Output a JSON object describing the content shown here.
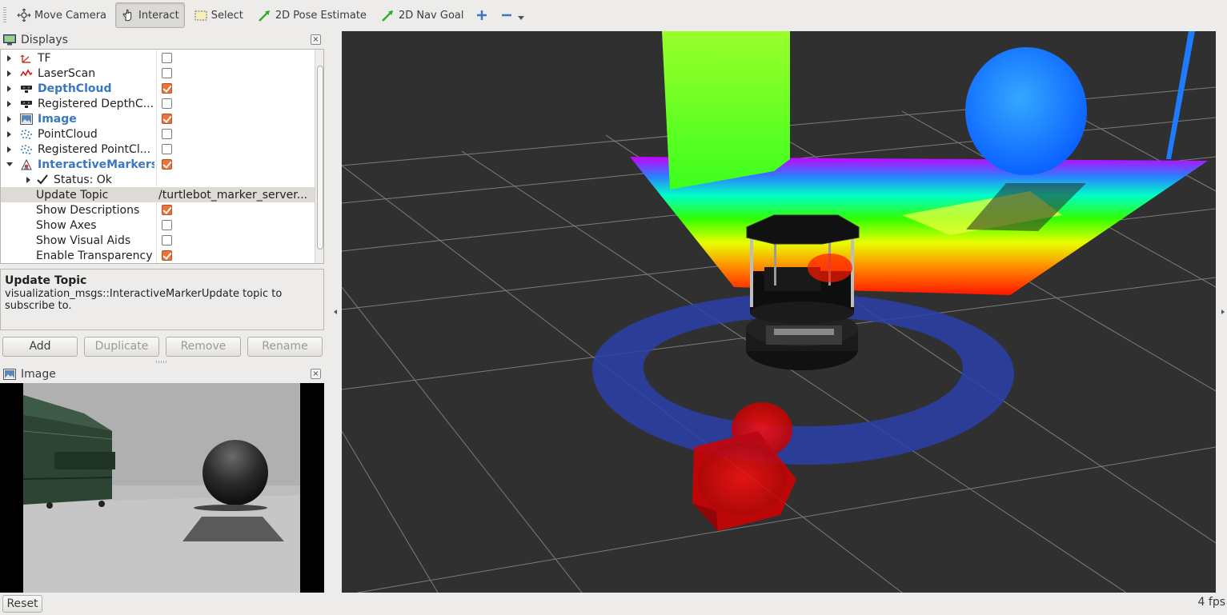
{
  "toolbar": {
    "tools": [
      {
        "label": "Move Camera",
        "active": false
      },
      {
        "label": "Interact",
        "active": true
      },
      {
        "label": "Select",
        "active": false
      },
      {
        "label": "2D Pose Estimate",
        "active": false
      },
      {
        "label": "2D Nav Goal",
        "active": false
      }
    ],
    "add_tool_icon": "plus-icon",
    "remove_tool_icon": "minus-icon"
  },
  "displays_panel": {
    "title": "Displays",
    "close_glyph": "×",
    "items": [
      {
        "label": "TF",
        "checked": false,
        "icon": "tf-icon",
        "highlight": false
      },
      {
        "label": "LaserScan",
        "checked": false,
        "icon": "laserscan-icon",
        "highlight": false
      },
      {
        "label": "DepthCloud",
        "checked": true,
        "icon": "depthcloud-icon",
        "highlight": true
      },
      {
        "label": "Registered DepthC...",
        "checked": false,
        "icon": "depthcloud-icon",
        "highlight": false
      },
      {
        "label": "Image",
        "checked": true,
        "icon": "image-icon",
        "highlight": true
      },
      {
        "label": "PointCloud",
        "checked": false,
        "icon": "pointcloud-icon",
        "highlight": false
      },
      {
        "label": "Registered PointCl...",
        "checked": false,
        "icon": "pointcloud-icon",
        "highlight": false
      },
      {
        "label": "InteractiveMarkers",
        "checked": true,
        "icon": "interactive-markers-icon",
        "highlight": true
      }
    ],
    "status": {
      "label": "Status: Ok",
      "icon": "checkmark-icon"
    },
    "properties": [
      {
        "label": "Update Topic",
        "value": "/turtlebot_marker_server...",
        "selected": true
      },
      {
        "label": "Show Descriptions",
        "checked": true
      },
      {
        "label": "Show Axes",
        "checked": false
      },
      {
        "label": "Show Visual Aids",
        "checked": false
      },
      {
        "label": "Enable Transparency",
        "checked": true
      }
    ]
  },
  "description": {
    "title": "Update Topic",
    "text": "visualization_msgs::InteractiveMarkerUpdate topic to subscribe to."
  },
  "buttons": {
    "add": "Add",
    "duplicate": "Duplicate",
    "remove": "Remove",
    "rename": "Rename"
  },
  "image_panel": {
    "title": "Image",
    "close_glyph": "×"
  },
  "statusbar": {
    "reset": "Reset",
    "fps": "4 fps"
  },
  "colors": {
    "viewport_bg": "#303030",
    "grid": "#8a8a8a",
    "checkbox_on": "#e8743b",
    "highlight_text": "#3a77c2",
    "ring": "#2a3fa8",
    "marker": "#e01010",
    "sphere": "#1e7dff"
  }
}
